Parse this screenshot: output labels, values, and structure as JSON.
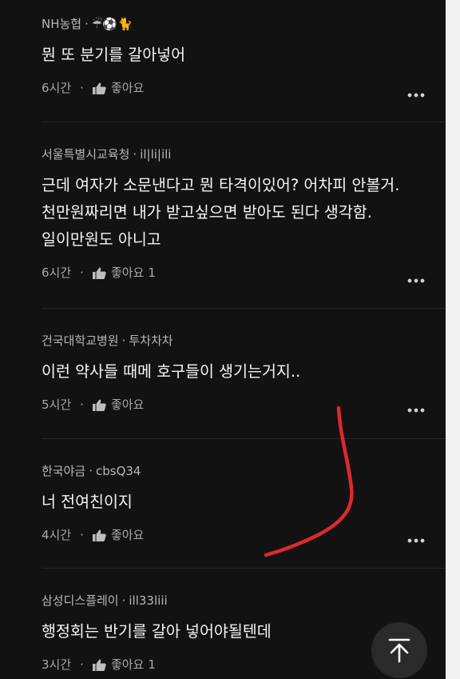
{
  "comments": [
    {
      "author": "NH농협",
      "nickname": "☔⚽🐈",
      "text_lines": [
        "뭔 또 분기를 갈아넣어"
      ],
      "time": "6시간",
      "like_label": "좋아요",
      "like_count": ""
    },
    {
      "author": "서울특별시교육청",
      "nickname": "il|li|ili",
      "text_lines": [
        "근데 여자가 소문낸다고 뭔 타격이있어? 어차피 안볼거.",
        "천만원짜리면 내가 받고싶으면 받아도 된다 생각함.",
        "일이만원도 아니고"
      ],
      "time": "6시간",
      "like_label": "좋아요",
      "like_count": "1"
    },
    {
      "author": "건국대학교병원",
      "nickname": "투차차차",
      "text_lines": [
        "이런 약사들 때메 호구들이 생기는거지.."
      ],
      "time": "5시간",
      "like_label": "좋아요",
      "like_count": ""
    },
    {
      "author": "한국야금",
      "nickname": "cbsQ34",
      "text_lines": [
        "너 전여친이지"
      ],
      "time": "4시간",
      "like_label": "좋아요",
      "like_count": ""
    },
    {
      "author": "삼성디스플레이",
      "nickname": "ill33liii",
      "text_lines": [
        "행정회는 반기를 갈아 넣어야될텐데"
      ],
      "time": "3시간",
      "like_label": "좋아요",
      "like_count": "1"
    }
  ],
  "separator": "·",
  "icons": {
    "like": "thumbs-up-icon",
    "more": "more-dots-icon",
    "scroll_top": "arrow-up-to-top-icon"
  },
  "colors": {
    "background": "#121212",
    "text": "#f5f5f5",
    "muted": "#a9a9a9",
    "annotation": "#e0282e"
  }
}
